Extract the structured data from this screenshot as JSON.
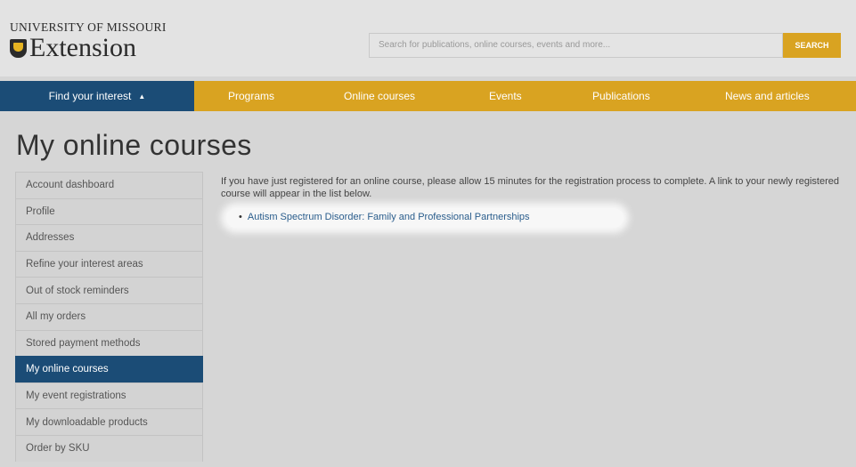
{
  "header": {
    "logo_top": "UNIVERSITY OF MISSOURI",
    "logo_word": "Extension",
    "search_placeholder": "Search for publications, online courses, events and more...",
    "search_button": "SEARCH"
  },
  "nav": {
    "find": "Find your interest",
    "caret": "▲",
    "items": [
      "Programs",
      "Online courses",
      "Events",
      "Publications",
      "News and articles"
    ]
  },
  "page_title": "My online courses",
  "sidebar": {
    "items": [
      "Account dashboard",
      "Profile",
      "Addresses",
      "Refine your interest areas",
      "Out of stock reminders",
      "All my orders",
      "Stored payment methods",
      "My online courses",
      "My event registrations",
      "My downloadable products",
      "Order by SKU"
    ],
    "active_index": 7
  },
  "main": {
    "notice": "If you have just registered for an online course, please allow 15 minutes for the registration process to complete. A link to your newly registered course will appear in the list below.",
    "courses": [
      "Autism Spectrum Disorder: Family and Professional Partnerships"
    ]
  },
  "colors": {
    "brand_gold": "#d9a321",
    "brand_blue": "#1b4c76",
    "link": "#2a5d8c"
  }
}
